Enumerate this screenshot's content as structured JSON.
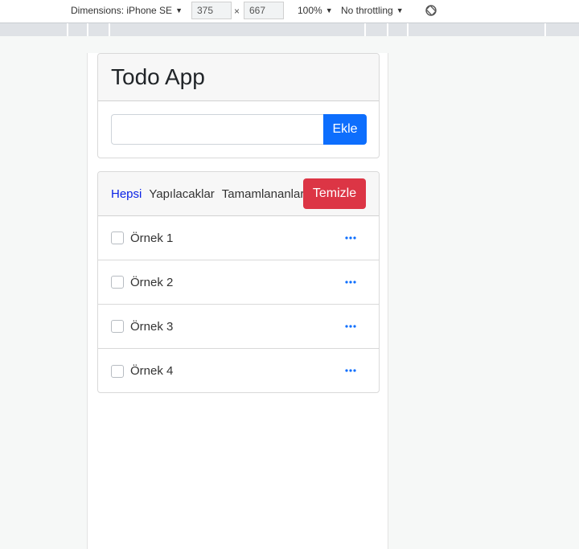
{
  "devtools": {
    "dimensions_label": "Dimensions: iPhone SE",
    "width_value": "375",
    "height_value": "667",
    "times_sign": "×",
    "zoom_label": "100%",
    "throttle_label": "No throttling",
    "rotate_icon": "rotate-icon"
  },
  "app": {
    "title": "Todo App",
    "input_placeholder": "",
    "input_value": "",
    "add_label": "Ekle",
    "clear_label": "Temizle",
    "colors": {
      "primary": "#0d6efd",
      "danger": "#dc3545",
      "active_filter": "#0b23e6"
    }
  },
  "filters": [
    {
      "label": "Hepsi",
      "active": true
    },
    {
      "label": "Yapılacaklar",
      "active": false
    },
    {
      "label": "Tamamlananlar",
      "active": false
    }
  ],
  "todos": [
    {
      "text": "Örnek 1",
      "done": false
    },
    {
      "text": "Örnek 2",
      "done": false
    },
    {
      "text": "Örnek 3",
      "done": false
    },
    {
      "text": "Örnek 4",
      "done": false
    }
  ]
}
